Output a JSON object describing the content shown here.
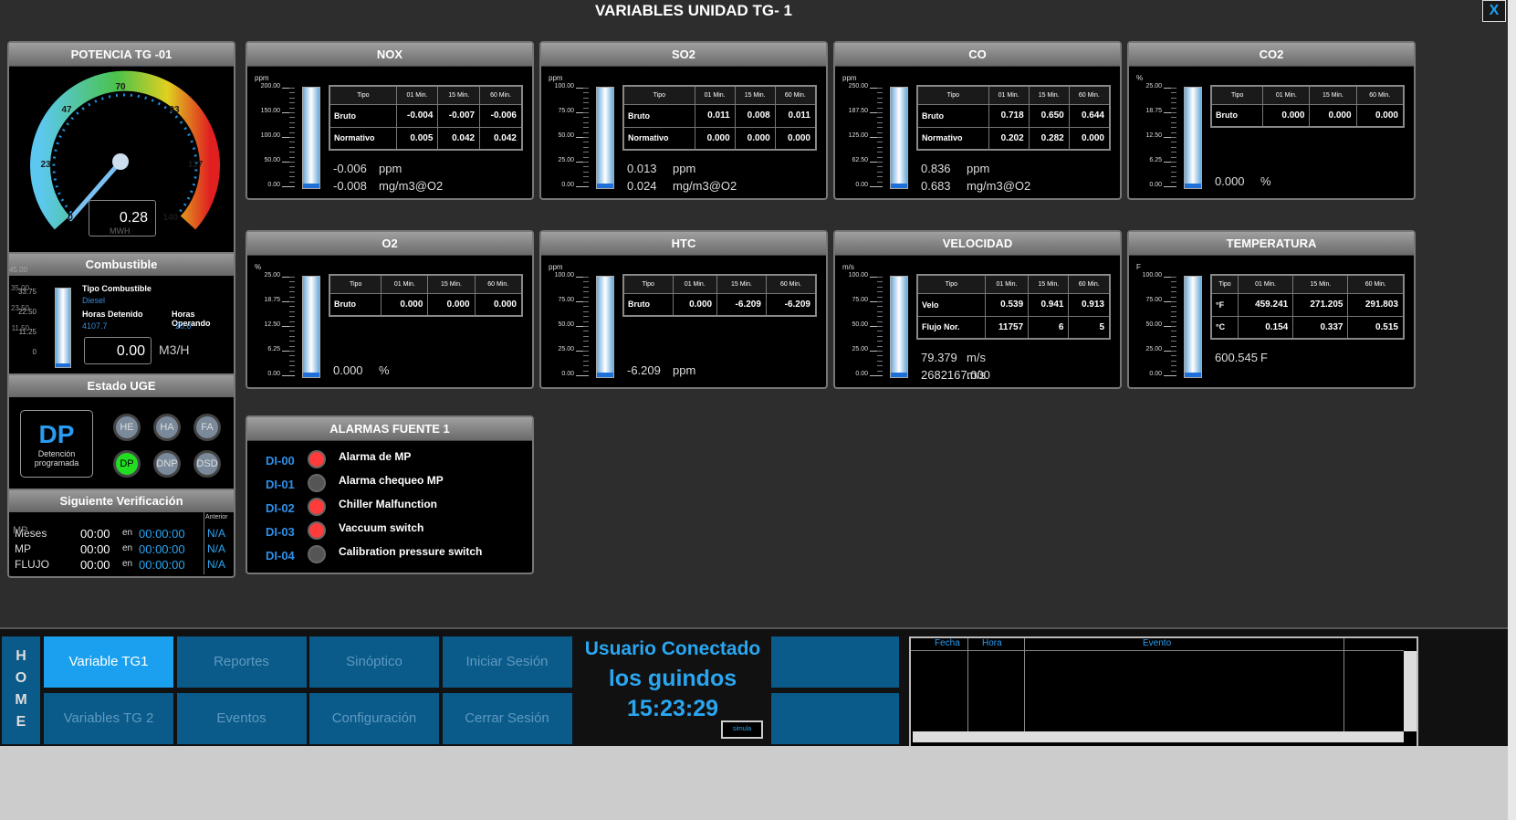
{
  "window": {
    "title": "VARIABLES UNIDAD TG-  1",
    "close_label": "X"
  },
  "potencia": {
    "title": "POTENCIA TG -01",
    "value": "0.28",
    "unit": "MWH",
    "ticks": [
      "0",
      "23",
      "47",
      "70",
      "93",
      "117",
      "140"
    ],
    "level_fraction": 0.002
  },
  "combustible": {
    "title": "Combustible",
    "scale": [
      "45.00",
      "33.75",
      "22.50",
      "11.25",
      "0"
    ],
    "scale_overlap": [
      "35.00",
      "23.50",
      "11.50"
    ],
    "tipo_label": "Tipo Combustible",
    "tipo_value": "Diesel",
    "detenido_label": "Horas Detenido",
    "detenido_value": "4107.7",
    "operando_label": "Horas Operando",
    "operando_value": "20.6",
    "flow_value": "0.00",
    "flow_unit": "M3/H"
  },
  "estado": {
    "title": "Estado UGE",
    "code": "DP",
    "desc1": "Detención",
    "desc2": "programada",
    "buttons": [
      "HE",
      "HA",
      "FA",
      "DP",
      "DNP",
      "DSD"
    ],
    "active": "DP"
  },
  "verif": {
    "title": "Siguiente Verificación",
    "anterior": "Anterior",
    "en": "en",
    "rows": [
      {
        "label": "Meses",
        "overlap": "MP",
        "time": "00:00",
        "count": "00:00:00",
        "prev": "N/A"
      },
      {
        "label": "MP",
        "time": "00:00",
        "count": "00:00:00",
        "prev": "N/A"
      },
      {
        "label": "FLUJO",
        "time": "00:00",
        "count": "00:00:00",
        "prev": "N/A"
      }
    ]
  },
  "table_headers": [
    "Tipo",
    "01 Min.",
    "15 Min.",
    "60 Min."
  ],
  "gauges": [
    {
      "title": "NOX",
      "unit": "ppm",
      "scale": [
        "200.00",
        "150.00",
        "100.00",
        "50.00",
        "0.00"
      ],
      "rows": [
        [
          "Bruto",
          "-0.004",
          "-0.007",
          "-0.006"
        ],
        [
          "Normativo",
          "0.005",
          "0.042",
          "0.042"
        ]
      ],
      "v1": "-0.006",
      "u1": "ppm",
      "v2": "-0.008",
      "u2": "mg/m3@O2",
      "level": 0.0
    },
    {
      "title": "SO2",
      "unit": "ppm",
      "scale": [
        "100.00",
        "75.00",
        "50.00",
        "25.00",
        "0.00"
      ],
      "rows": [
        [
          "Bruto",
          "0.011",
          "0.008",
          "0.011"
        ],
        [
          "Normativo",
          "0.000",
          "0.000",
          "0.000"
        ]
      ],
      "v1": "0.013",
      "u1": "ppm",
      "v2": "0.024",
      "u2": "mg/m3@O2",
      "level": 0.0
    },
    {
      "title": "CO",
      "unit": "ppm",
      "scale": [
        "250.00",
        "187.50",
        "125.00",
        "62.50",
        "0.00"
      ],
      "rows": [
        [
          "Bruto",
          "0.718",
          "0.650",
          "0.644"
        ],
        [
          "Normativo",
          "0.202",
          "0.282",
          "0.000"
        ]
      ],
      "v1": "0.836",
      "u1": "ppm",
      "v2": "0.683",
      "u2": "mg/m3@O2",
      "level": 0.0
    },
    {
      "title": "CO2",
      "unit": "%",
      "scale": [
        "25.00",
        "18.75",
        "12.50",
        "6.25",
        "0.00"
      ],
      "rows": [
        [
          "Bruto",
          "0.000",
          "0.000",
          "0.000"
        ]
      ],
      "v1": "0.000",
      "u1": "%",
      "v2": "",
      "u2": "",
      "level": 0.0
    },
    {
      "title": "O2",
      "unit": "%",
      "scale": [
        "25.00",
        "18.75",
        "12.50",
        "6.25",
        "0.00"
      ],
      "rows": [
        [
          "Bruto",
          "0.000",
          "0.000",
          "0.000"
        ]
      ],
      "v1": "0.000",
      "u1": "%",
      "v2": "",
      "u2": "",
      "level": 0.0
    },
    {
      "title": "HTC",
      "unit": "ppm",
      "scale": [
        "100.00",
        "75.00",
        "50.00",
        "25.00",
        "0.00"
      ],
      "rows": [
        [
          "Bruto",
          "0.000",
          "-6.209",
          "-6.209"
        ]
      ],
      "v1": "-6.209",
      "u1": "ppm",
      "v2": "",
      "u2": "",
      "level": 0.0
    },
    {
      "title": "VELOCIDAD",
      "unit": "m/s",
      "scale": [
        "100.00",
        "75.00",
        "50.00",
        "25.00",
        "0.00"
      ],
      "rows": [
        [
          "Velo",
          "0.539",
          "0.941",
          "0.913"
        ],
        [
          "Flujo Nor.",
          "11757",
          "6",
          "5"
        ]
      ],
      "v1": "79.379",
      "u1": "m/s",
      "v2": "2682167.000",
      "u2": "m/s",
      "level": 0.0
    },
    {
      "title": "TEMPERATURA",
      "unit": "F",
      "scale": [
        "100.00",
        "75.00",
        "50.00",
        "25.00",
        "0.00"
      ],
      "rows": [
        [
          "°F",
          "459.241",
          "271.205",
          "291.803"
        ],
        [
          "°C",
          "0.154",
          "0.337",
          "0.515"
        ]
      ],
      "v1": "600.545",
      "u1": "F",
      "v2": "",
      "u2": "",
      "level": 0.0
    }
  ],
  "alarmas": {
    "title": "ALARMAS FUENTE 1",
    "items": [
      {
        "id": "DI-00",
        "name": "Alarma de MP",
        "on": true
      },
      {
        "id": "DI-01",
        "name": "Alarma chequeo MP",
        "on": false
      },
      {
        "id": "DI-02",
        "name": "Chiller Malfunction",
        "on": true
      },
      {
        "id": "DI-03",
        "name": "Vaccuum switch",
        "on": true
      },
      {
        "id": "DI-04",
        "name": "Calibration pressure switch",
        "on": false
      }
    ]
  },
  "colors": {
    "active_nav": "#1aa0ee",
    "nav": "#0a5a8a",
    "alarm_on": "#ff3b3b",
    "alarm_off": "#555555",
    "dp_active": "#22dd22"
  },
  "nav": {
    "home": [
      "H",
      "O",
      "M",
      "E"
    ],
    "buttons": [
      [
        "Variable TG1",
        "Reportes",
        "Sinóptico",
        "Iniciar Sesión"
      ],
      [
        "Variables TG 2",
        "Eventos",
        "Configuración",
        "Cerrar Sesión"
      ]
    ],
    "active": "Variable TG1"
  },
  "user": {
    "label": "Usuario Conectado",
    "name": "los guindos",
    "time": "15:23:29",
    "simula": "simula"
  },
  "events": {
    "cols": [
      "Fecha",
      "Hora",
      "Evento"
    ]
  }
}
